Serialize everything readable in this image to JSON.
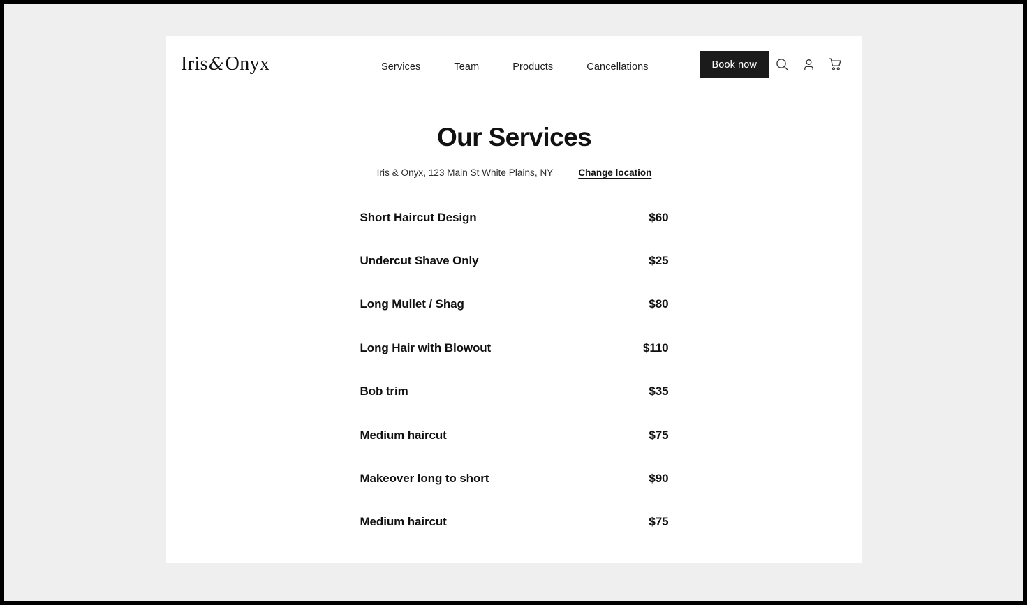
{
  "brand": {
    "name_part1": "Iris",
    "ampersand": "&",
    "name_part2": "Onyx"
  },
  "header": {
    "nav": [
      {
        "label": "Services"
      },
      {
        "label": "Team"
      },
      {
        "label": "Products"
      },
      {
        "label": "Cancellations"
      }
    ],
    "book_now_label": "Book now",
    "icons": [
      {
        "name": "search-icon"
      },
      {
        "name": "account-icon"
      },
      {
        "name": "cart-icon"
      }
    ]
  },
  "page": {
    "title": "Our Services",
    "location_text": "Iris & Onyx, 123 Main St White Plains, NY",
    "change_location_label": "Change location"
  },
  "services": [
    {
      "name": "Short Haircut Design",
      "price": "$60"
    },
    {
      "name": "Undercut Shave Only",
      "price": "$25"
    },
    {
      "name": "Long Mullet / Shag",
      "price": "$80"
    },
    {
      "name": "Long Hair with Blowout",
      "price": "$110"
    },
    {
      "name": "Bob trim",
      "price": "$35"
    },
    {
      "name": "Medium haircut",
      "price": "$75"
    },
    {
      "name": "Makeover long to short",
      "price": "$90"
    },
    {
      "name": "Medium haircut",
      "price": "$75"
    }
  ],
  "colors": {
    "page_background": "#efefef",
    "card_background": "#ffffff",
    "text_primary": "#111111",
    "button_background": "#1b1b1b",
    "button_text": "#ffffff",
    "frame": "#000000"
  }
}
